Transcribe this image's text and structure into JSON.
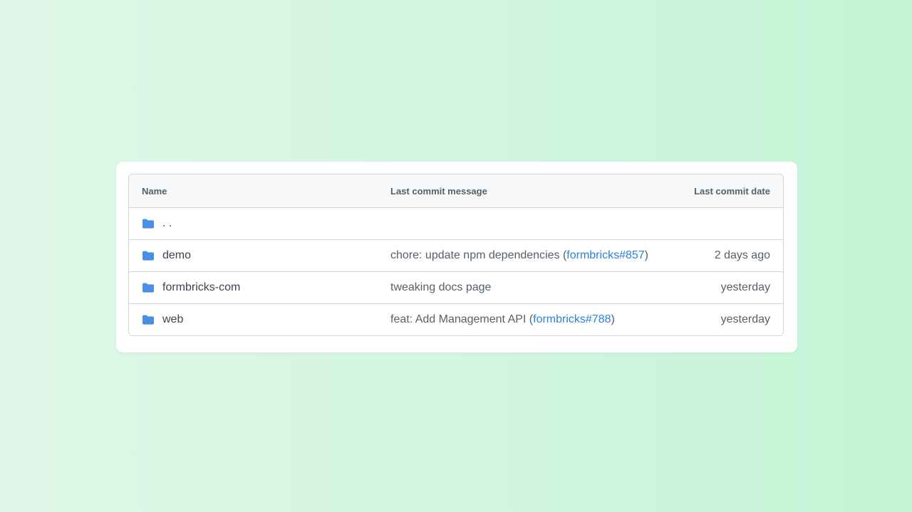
{
  "table": {
    "headers": {
      "name": "Name",
      "message": "Last commit message",
      "date": "Last commit date"
    },
    "parent_dir": {
      "name": ". ."
    },
    "rows": [
      {
        "name": "demo",
        "message_prefix": "chore: update npm dependencies (",
        "message_link": "formbricks#857",
        "message_suffix": ")",
        "date": "2 days ago"
      },
      {
        "name": "formbricks-com",
        "message_prefix": "tweaking docs page",
        "message_link": "",
        "message_suffix": "",
        "date": "yesterday"
      },
      {
        "name": "web",
        "message_prefix": "feat: Add Management API (",
        "message_link": "formbricks#788",
        "message_suffix": ")",
        "date": "yesterday"
      }
    ]
  },
  "icons": {
    "folder": "folder-icon"
  },
  "colors": {
    "folder": "#4a90e2",
    "link": "#2f7fd8",
    "text": "#57606a",
    "header_bg": "#f6f8fa",
    "border": "#d0d7de"
  }
}
